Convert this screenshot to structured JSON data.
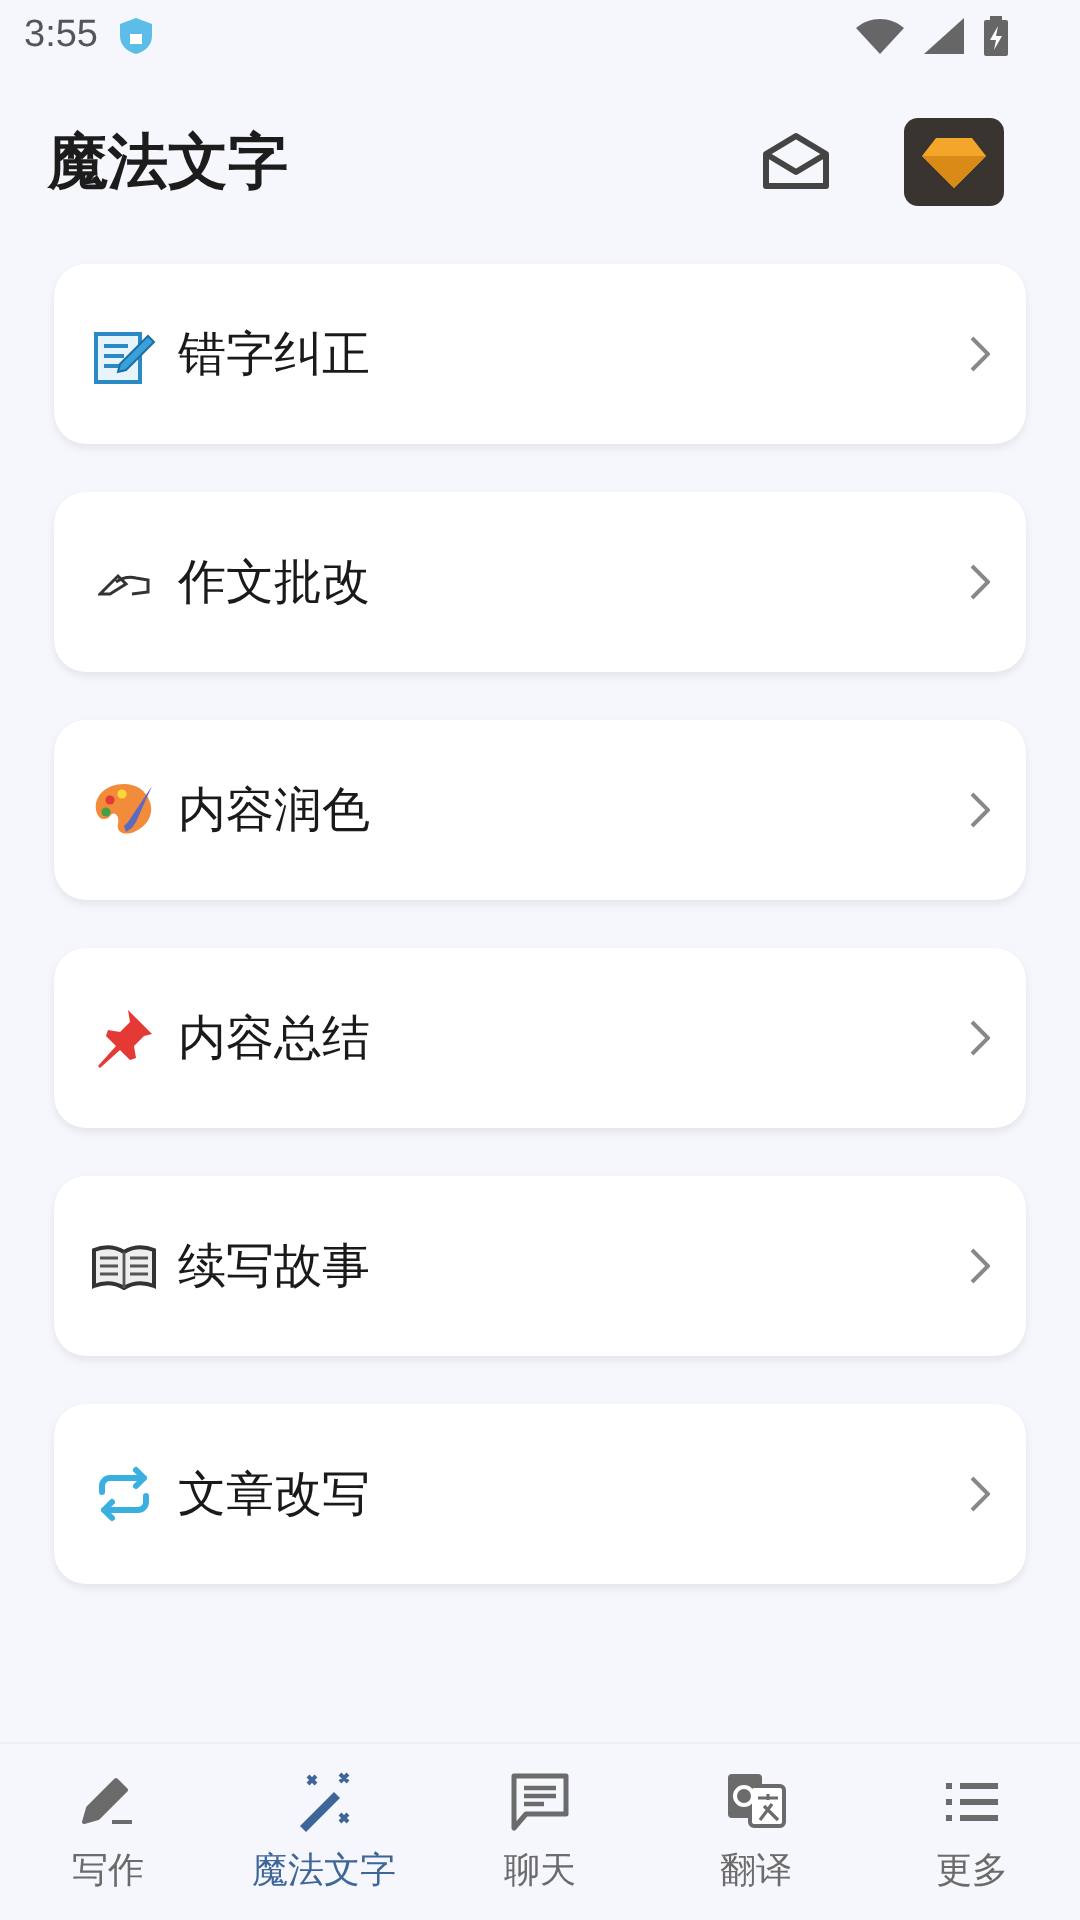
{
  "status_bar": {
    "time": "3:55"
  },
  "header": {
    "title": "魔法文字"
  },
  "menu": [
    {
      "label": "错字纠正"
    },
    {
      "label": "作文批改"
    },
    {
      "label": "内容润色"
    },
    {
      "label": "内容总结"
    },
    {
      "label": "续写故事"
    },
    {
      "label": "文章改写"
    }
  ],
  "bottom_nav": [
    {
      "label": "写作",
      "selected": false
    },
    {
      "label": "魔法文字",
      "selected": true
    },
    {
      "label": "聊天",
      "selected": false
    },
    {
      "label": "翻译",
      "selected": false
    },
    {
      "label": "更多",
      "selected": false
    }
  ]
}
